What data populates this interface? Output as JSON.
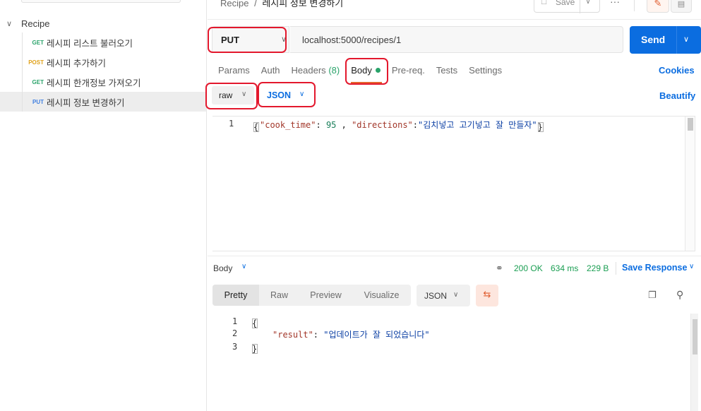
{
  "sidebar": {
    "collection_name": "Recipe",
    "requests": [
      {
        "method": "GET",
        "name": "레시피 리스트 불러오기"
      },
      {
        "method": "POST",
        "name": "레시피 추가하기"
      },
      {
        "method": "GET",
        "name": "레시피 한개정보 가져오기"
      },
      {
        "method": "PUT",
        "name": "레시피 정보 변경하기"
      }
    ]
  },
  "header": {
    "breadcrumb_root": "Recipe",
    "breadcrumb_sep": "/",
    "breadcrumb_current": "레시피 정보 변경하기",
    "save_label": "Save"
  },
  "request": {
    "method": "PUT",
    "url": "localhost:5000/recipes/1",
    "send_label": "Send"
  },
  "tabs": [
    {
      "label": "Params"
    },
    {
      "label": "Auth"
    },
    {
      "label": "Headers",
      "count": "(8)"
    },
    {
      "label": "Body"
    },
    {
      "label": "Pre-req."
    },
    {
      "label": "Tests"
    },
    {
      "label": "Settings"
    }
  ],
  "cookies_label": "Cookies",
  "body": {
    "mode": "raw",
    "language": "JSON",
    "beautify_label": "Beautify",
    "line_number": "1",
    "tokens": {
      "open": "{",
      "key1": "\"cook_time\"",
      "colon1": ": ",
      "val1": "95",
      "comma": " , ",
      "key2": "\"directions\"",
      "colon2": ":",
      "val2": "\"김치넣고 고기넣고 잘 만들자\"",
      "close": "}"
    }
  },
  "response": {
    "body_label": "Body",
    "status": "200 OK",
    "time": "634 ms",
    "size": "229 B",
    "save_response_label": "Save Response",
    "views": [
      "Pretty",
      "Raw",
      "Preview",
      "Visualize"
    ],
    "format": "JSON",
    "lines": [
      {
        "num": "1",
        "text": "{"
      },
      {
        "num": "2",
        "key": "\"result\"",
        "sep": ": ",
        "value": "\"업데이트가 잘 되었습니다\""
      },
      {
        "num": "3",
        "text": "}"
      }
    ]
  }
}
